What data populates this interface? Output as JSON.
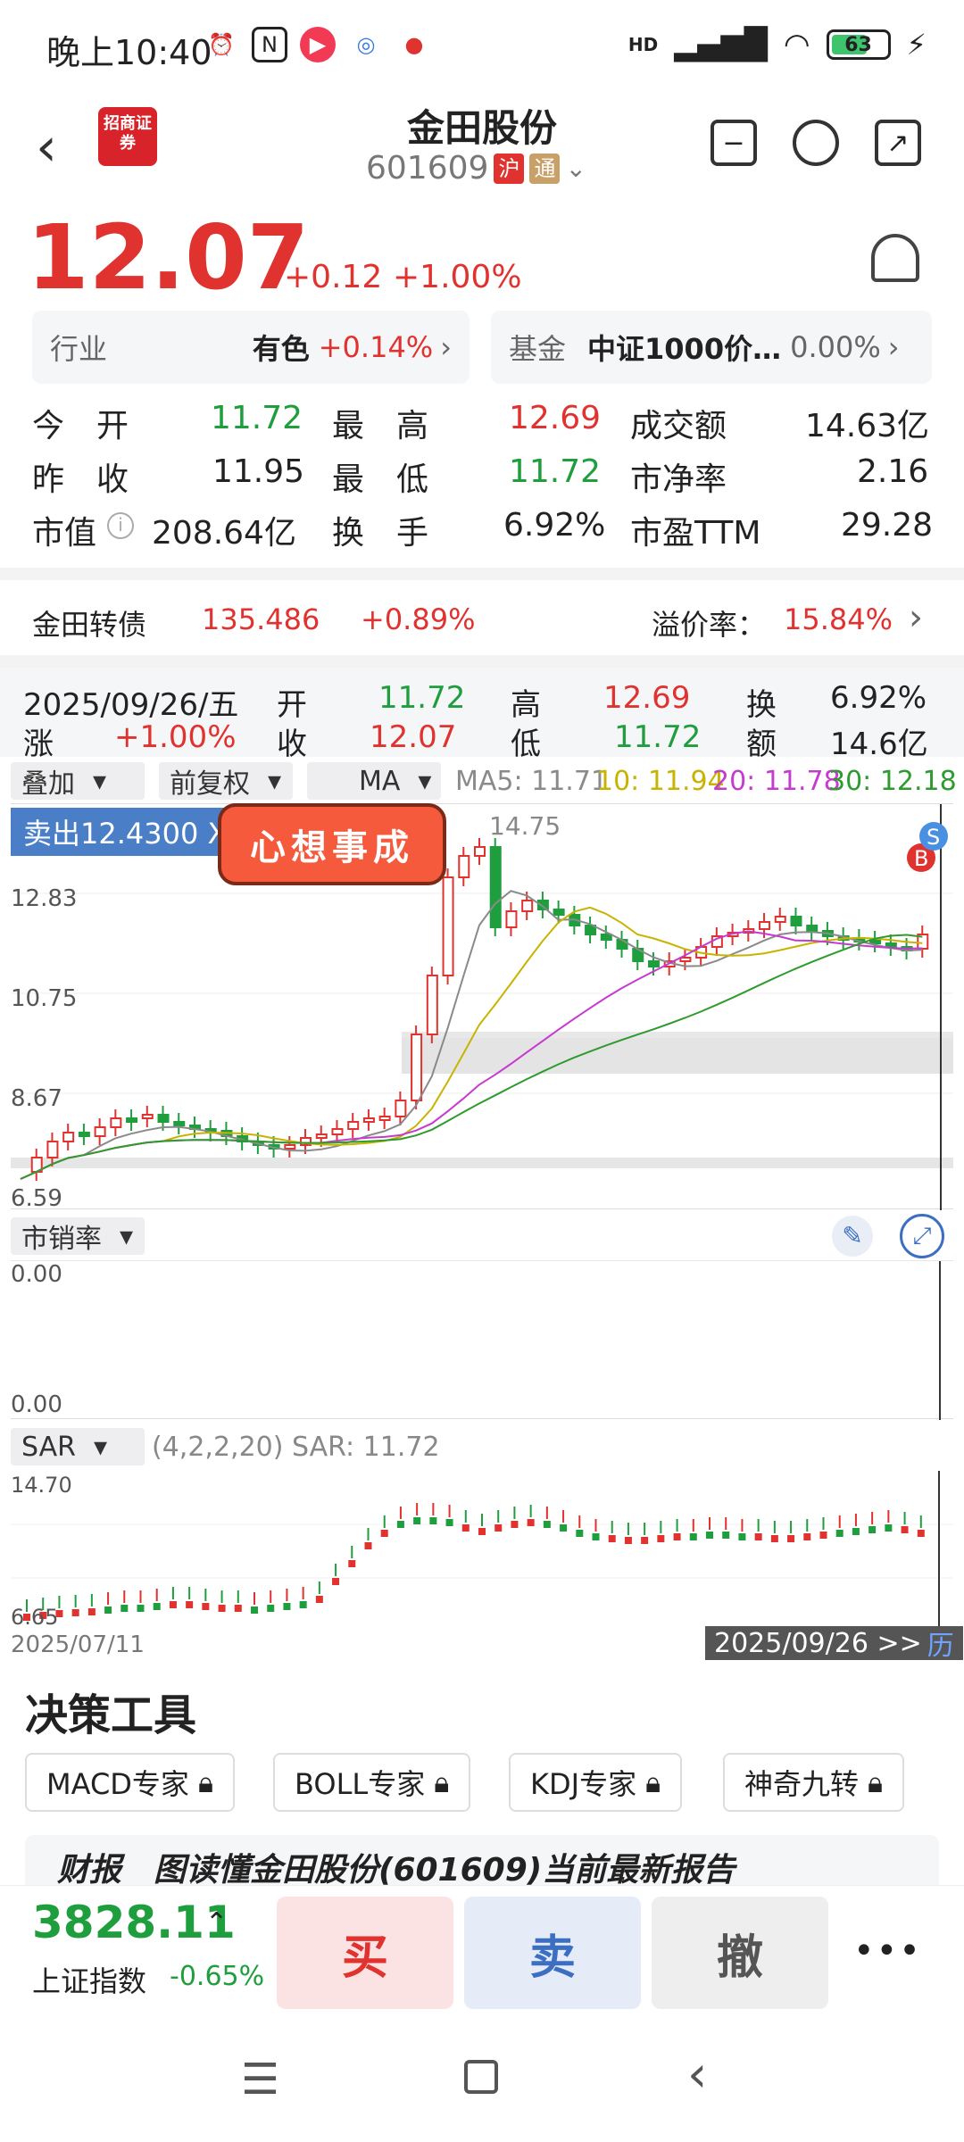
{
  "status_bar": {
    "time": "晚上10:40",
    "battery": "63",
    "network": "HD"
  },
  "header": {
    "title": "金田股份",
    "code": "601609",
    "tag_hu": "沪",
    "tag_tong": "通",
    "logo_text": "招商证券"
  },
  "price": {
    "last": "12.07",
    "change": "+0.12",
    "change_pct": "+1.00%"
  },
  "boxes": {
    "industry_label": "行业",
    "industry_value": "有色",
    "industry_pct": "+0.14%",
    "fund_label": "基金",
    "fund_value": "中证1000价…",
    "fund_pct": "0.00%"
  },
  "quote": {
    "open_label": "今　开",
    "open": "11.72",
    "high_label": "最　高",
    "high": "12.69",
    "amount_label": "成交额",
    "amount": "14.63亿",
    "prev_label": "昨　收",
    "prev": "11.95",
    "low_label": "最　低",
    "low": "11.72",
    "pb_label": "市净率",
    "pb": "2.16",
    "mcap_label": "市值",
    "mcap": "208.64亿",
    "turnover_label": "换　手",
    "turnover": "6.92%",
    "pe_label": "市盈TTM",
    "pe": "29.28"
  },
  "bond": {
    "name": "金田转债",
    "price": "135.486",
    "pct": "+0.89%",
    "premium_label": "溢价率：",
    "premium": "15.84%"
  },
  "day_stats": {
    "date": "2025/09/26/五",
    "open_l": "开",
    "open": "11.72",
    "high_l": "高",
    "high": "12.69",
    "turn_l": "换",
    "turn": "6.92%",
    "chg_l": "涨",
    "chg": "+1.00%",
    "close_l": "收",
    "close": "12.07",
    "low_l": "低",
    "low": "11.72",
    "amt_l": "额",
    "amt": "14.6亿"
  },
  "chart_toolbar": {
    "overlay": "叠加",
    "adjust": "前复权",
    "ma": "MA",
    "ma5": "MA5: 11.71",
    "ma10": "10: 11.94",
    "ma20": "20: 11.78",
    "ma30": "30: 12.18"
  },
  "kline": {
    "sell_label": "卖出12.4300 X",
    "sticker": "心想事成",
    "peak_label": "14.75",
    "y_labels": [
      "12.83",
      "10.75",
      "8.67",
      "6.59"
    ],
    "marker_b": "B",
    "marker_s": "S"
  },
  "ps_indicator": {
    "name": "市销率",
    "top": "0.00",
    "bottom": "0.00"
  },
  "sar": {
    "name": "SAR",
    "params": "(4,2,2,20) SAR: 11.72",
    "top": "14.70",
    "bottom": "6.65",
    "start_date": "2025/07/11",
    "end_date": "2025/09/26 >>",
    "history": "历"
  },
  "decision": {
    "title": "决策工具",
    "tools": [
      "MACD专家",
      "BOLL专家",
      "KDJ专家",
      "神奇九转"
    ],
    "report": "财报　图读懂金田股份(601609)当前最新报告"
  },
  "tradebar": {
    "index_value": "3828.11",
    "index_name": "上证指数",
    "index_pct": "-0.65%",
    "buy": "买",
    "sell": "卖",
    "cancel": "撤",
    "more": "•••"
  },
  "colors": {
    "up": "#e0322e",
    "down": "#1f9e3e",
    "ma5": "#8a8a8a",
    "ma10": "#c8b400",
    "ma20": "#c53bd0",
    "ma30": "#2e9b2e"
  }
}
